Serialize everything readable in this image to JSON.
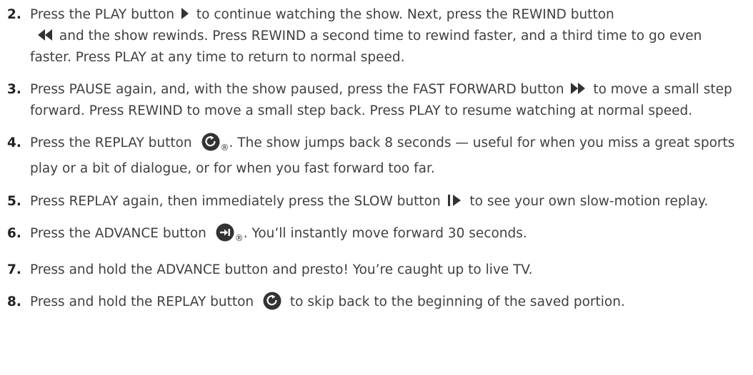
{
  "steps": [
    {
      "number": "2.",
      "parts": [
        "Press the PLAY button ",
        " to continue watching the show. Next, press the REWIND button ",
        " and the show rewinds. Press REWIND a second time to rewind faster, and a third time to go even faster. Press PLAY at any time to return to normal speed."
      ],
      "icons": [
        "play-icon",
        "rewind-icon"
      ]
    },
    {
      "number": "3.",
      "parts": [
        "Press PAUSE again, and, with the show paused, press the FAST FORWARD button ",
        " to move a small step forward. Press REWIND to move a small step back. Press PLAY to resume watching at normal speed."
      ],
      "icons": [
        "fast-forward-icon"
      ]
    },
    {
      "number": "4.",
      "parts": [
        "Press the REPLAY button ",
        ". The show jumps back 8 seconds — useful for when you miss a great sports play or a bit of dialogue, or for when you fast forward too far."
      ],
      "icons": [
        "replay-icon"
      ],
      "trademark": "®"
    },
    {
      "number": "5.",
      "parts": [
        "Press REPLAY again, then immediately press the SLOW button ",
        " to see your own slow-motion replay."
      ],
      "icons": [
        "slow-icon"
      ]
    },
    {
      "number": "6.",
      "parts": [
        "Press the ADVANCE button ",
        ". You’ll instantly move forward 30 seconds."
      ],
      "icons": [
        "advance-icon"
      ],
      "trademark": "®"
    },
    {
      "number": "7.",
      "parts": [
        "Press and hold the ADVANCE button and presto! You’re caught up to live TV."
      ],
      "icons": []
    },
    {
      "number": "8.",
      "parts": [
        "Press and hold the REPLAY button ",
        " to skip back to the beginning of the saved portion."
      ],
      "icons": [
        "replay-icon"
      ]
    }
  ],
  "colors": {
    "text": "#404040",
    "number": "#222222",
    "icon": "#333333"
  }
}
